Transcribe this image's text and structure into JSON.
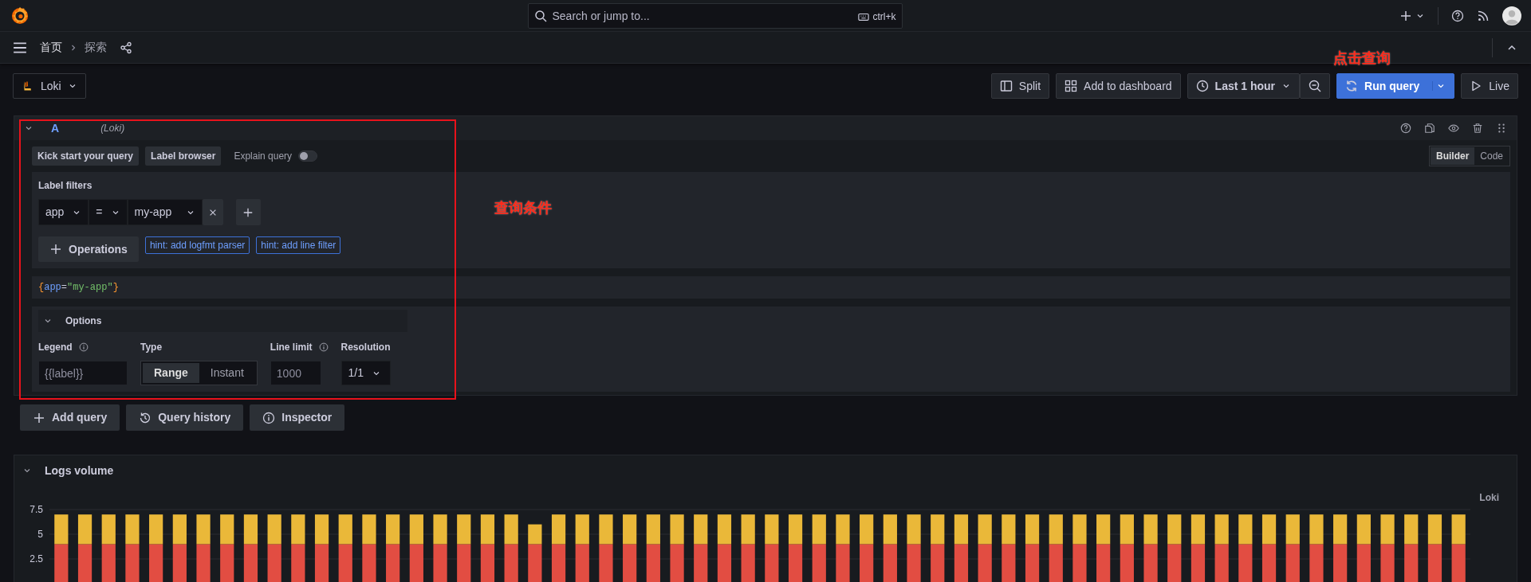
{
  "top_bar": {
    "search": {
      "placeholder": "Search or jump to...",
      "shortcut": "ctrl+k"
    }
  },
  "breadcrumbs": [
    {
      "label": "首页",
      "selected": false
    },
    {
      "label": "探索",
      "selected": true
    }
  ],
  "toolbar": {
    "datasource": "Loki",
    "split": "Split",
    "add_to_dashboard": "Add to dashboard",
    "time_range": "Last 1 hour",
    "run_query": "Run query",
    "live": "Live"
  },
  "query": {
    "ref_id": "A",
    "datasource": "(Loki)",
    "expanded": true,
    "actions": [
      "Kick start your query",
      "Label browser"
    ],
    "explain_query": {
      "label": "Explain query",
      "on": false
    },
    "modes": [
      {
        "label": "Builder",
        "selected": true
      },
      {
        "label": "Code",
        "selected": false
      }
    ],
    "label_filters_title": "Label filters",
    "filters": [
      {
        "label": "app",
        "operator": "=",
        "value": "my-app"
      }
    ],
    "operations": "Operations",
    "hints": [
      "hint: add logfmt parser",
      "hint: add line filter"
    ],
    "code": [
      {
        "text": "{",
        "kind": "brace"
      },
      {
        "text": "app",
        "kind": "key"
      },
      {
        "text": "=",
        "kind": "operator"
      },
      {
        "text": "\"my-app\"",
        "kind": "string"
      },
      {
        "text": "}",
        "kind": "brace"
      }
    ],
    "options": {
      "title": "Options",
      "expanded": true,
      "legend": {
        "label": "Legend",
        "placeholder": "{{label}}"
      },
      "type": {
        "label": "Type",
        "choices": [
          {
            "label": "Range",
            "selected": true
          },
          {
            "label": "Instant",
            "selected": false
          }
        ]
      },
      "line_limit": {
        "label": "Line limit",
        "placeholder": "1000"
      },
      "resolution": {
        "label": "Resolution",
        "value": "1/1"
      }
    }
  },
  "query_buttons": [
    "Add query",
    "Query history",
    "Inspector"
  ],
  "logs_volume": {
    "title": "Logs volume",
    "expanded": true,
    "source_label": "Loki",
    "chart_data": {
      "type": "bar",
      "stacked": true,
      "grid": true,
      "ylim": [
        0,
        7.5
      ],
      "yticks": [
        2.5,
        5,
        7.5
      ],
      "series": [
        {
          "color": "#e24d42",
          "values": [
            4,
            4,
            4,
            4,
            4,
            4,
            4,
            4,
            4,
            4,
            4,
            4,
            4,
            4,
            4,
            4,
            4,
            4,
            4,
            4,
            4,
            4,
            4,
            4,
            4,
            4,
            4,
            4,
            4,
            4,
            4,
            4,
            4,
            4,
            4,
            4,
            4,
            4,
            4,
            4,
            4,
            4,
            4,
            4,
            4,
            4,
            4,
            4,
            4,
            4,
            4,
            4,
            4,
            4,
            4,
            4,
            4,
            4,
            4,
            4
          ]
        },
        {
          "color": "#eab839",
          "values": [
            3,
            3,
            3,
            3,
            3,
            3,
            3,
            3,
            3,
            3,
            3,
            3,
            3,
            3,
            3,
            3,
            3,
            3,
            3,
            3,
            2,
            3,
            3,
            3,
            3,
            3,
            3,
            3,
            3,
            3,
            3,
            3,
            3,
            3,
            3,
            3,
            3,
            3,
            3,
            3,
            3,
            3,
            3,
            3,
            3,
            3,
            3,
            3,
            3,
            3,
            3,
            3,
            3,
            3,
            3,
            3,
            3,
            3,
            3,
            3
          ]
        }
      ]
    }
  },
  "annotations": [
    {
      "text": "点击查询"
    },
    {
      "text": "查询条件"
    }
  ]
}
